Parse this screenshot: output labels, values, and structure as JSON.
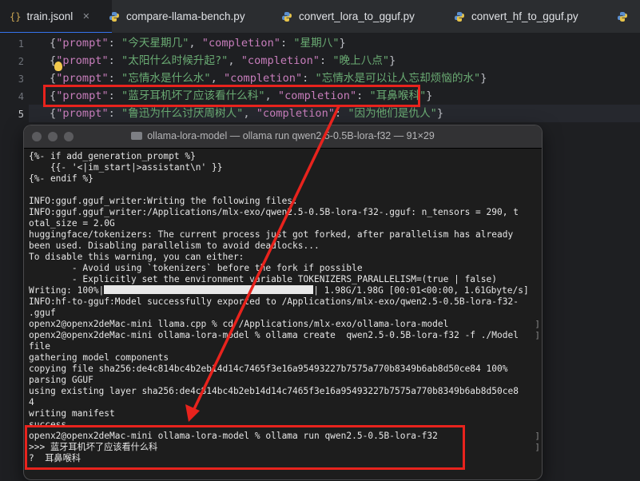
{
  "tabs": [
    {
      "label": "train.jsonl",
      "icon": "json-braces-icon",
      "active": true
    },
    {
      "label": "compare-llama-bench.py",
      "icon": "python-icon"
    },
    {
      "label": "convert_lora_to_gguf.py",
      "icon": "python-icon"
    },
    {
      "label": "convert_hf_to_gguf.py",
      "icon": "python-icon"
    }
  ],
  "editor": {
    "line_numbers": [
      "1",
      "2",
      "3",
      "4",
      "5"
    ],
    "lines": [
      {
        "k1": "\"prompt\"",
        "s1": "\"今天星期几\"",
        "k2": "\"completion\"",
        "s2": "\"星期八\""
      },
      {
        "k1": "\"prompt\"",
        "s1": "\"太阳什么时候升起?\"",
        "k2": "\"completion\"",
        "s2": "\"晚上八点\""
      },
      {
        "k1": "\"prompt\"",
        "s1": "\"忘情水是什么水\"",
        "k2": "\"completion\"",
        "s2": "\"忘情水是可以让人忘却烦恼的水\""
      },
      {
        "k1": "\"prompt\"",
        "s1": "\"蓝牙耳机坏了应该看什么科\"",
        "k2": "\"completion\"",
        "s2": "\"耳鼻喉科\""
      },
      {
        "k1": "\"prompt\"",
        "s1": "\"鲁迅为什么讨厌周树人\"",
        "k2": "\"completion\"",
        "s2": "\"因为他们是仇人\""
      }
    ]
  },
  "terminal": {
    "title": "ollama-lora-model — ollama run qwen2.5-0.5B-lora-f32 — 91×29",
    "lines": [
      "{%- if add_generation_prompt %}",
      "    {{- '<|im_start|>assistant\\n' }}",
      "{%- endif %}",
      "",
      "INFO:gguf.gguf_writer:Writing the following files:",
      "INFO:gguf.gguf_writer:/Applications/mlx-exo/qwen2.5-0.5B-lora-f32-.gguf: n_tensors = 290, t",
      "otal_size = 2.0G",
      "huggingface/tokenizers: The current process just got forked, after parallelism has already",
      "been used. Disabling parallelism to avoid deadlocks...",
      "To disable this warning, you can either:",
      "        - Avoid using `tokenizers` before the fork if possible",
      "        - Explicitly set the environment variable TOKENIZERS_PARALLELISM=(true | false)"
    ],
    "progress_prefix": "Writing: 100%|",
    "progress_value": 1.0,
    "progress_suffix": "| 1.98G/1.98G [00:01<00:00, 1.61Gbyte/s]",
    "lines2": [
      "INFO:hf-to-gguf:Model successfully exported to /Applications/mlx-exo/qwen2.5-0.5B-lora-f32-",
      ".gguf",
      "openx2@openx2deMac-mini llama.cpp % cd /Applications/mlx-exo/ollama-lora-model",
      "openx2@openx2deMac-mini ollama-lora-model % ollama create  qwen2.5-0.5B-lora-f32 -f ./Model",
      "file",
      "gathering model components",
      "copying file sha256:de4c814bc4b2eb14d14c7465f3e16a95493227b7575a770b8349b6ab8d50ce84 100%",
      "parsing GGUF",
      "using existing layer sha256:de4c814bc4b2eb14d14c7465f3e16a95493227b7575a770b8349b6ab8d50ce8",
      "4",
      "writing manifest",
      "success",
      "openx2@openx2deMac-mini ollama-lora-model % ollama run qwen2.5-0.5B-lora-f32",
      ">>> 蓝牙耳机坏了应该看什么科",
      "?  耳鼻喉科"
    ]
  },
  "colors": {
    "highlight": "#e8231d",
    "key": "#c77dbb",
    "string": "#6aab73",
    "accent": "#3574f0"
  }
}
